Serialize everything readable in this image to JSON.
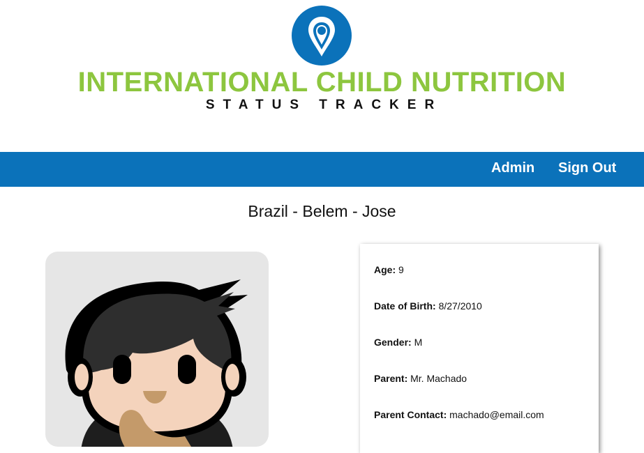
{
  "header": {
    "logo_title": "INTERNATIONAL CHILD NUTRITION",
    "logo_subtitle": "STATUS TRACKER",
    "logo_pin_color": "#0b72ba",
    "logo_title_color": "#8dc63f"
  },
  "nav": {
    "background": "#0b72ba",
    "admin_label": "Admin",
    "signout_label": "Sign Out"
  },
  "page": {
    "title": "Brazil - Belem - Jose"
  },
  "child": {
    "avatar_icon": "child-avatar-icon",
    "fields": [
      {
        "label": "Age:",
        "value": "9"
      },
      {
        "label": "Date of Birth:",
        "value": "8/27/2010"
      },
      {
        "label": "Gender:",
        "value": "M"
      },
      {
        "label": "Parent:",
        "value": "Mr. Machado"
      },
      {
        "label": "Parent Contact:",
        "value": "machado@email.com"
      }
    ]
  }
}
